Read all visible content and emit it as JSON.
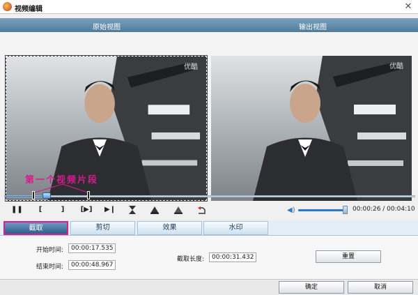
{
  "window": {
    "title": "视频编辑",
    "close_glyph": "✕"
  },
  "view_header": {
    "original_label": "原始视图",
    "output_label": "输出视图"
  },
  "preview": {
    "watermark": "优酷",
    "segment_note": "第一个视频片段"
  },
  "playback": {
    "current_time": "00:00:26",
    "total_time": "00:04:10",
    "timecode_display": "00:00:26 / 00:04:10",
    "progress_fraction": 0.104,
    "volume_fraction": 0.95,
    "buttons": {
      "pause": "❚❚",
      "mark_in": "[",
      "mark_out": "]",
      "play_segment": "[▶]",
      "step_to_end": "▶❙",
      "icons": [
        "pause-icon",
        "mark-in-icon",
        "mark-out-icon",
        "play-segment-icon",
        "step-end-icon",
        "cut-icon",
        "left-align-icon",
        "right-align-icon",
        "undo-icon"
      ]
    }
  },
  "tabs": [
    {
      "label": "截取",
      "active": true
    },
    {
      "label": "剪切",
      "active": false
    },
    {
      "label": "效果",
      "active": false
    },
    {
      "label": "水印",
      "active": false
    }
  ],
  "trim_panel": {
    "start_label": "开始时间:",
    "start_value": "00:00:17.535",
    "end_label": "结束时间:",
    "end_value": "00:00:48.967",
    "length_label": "截取长度:",
    "length_value": "00:00:31.432",
    "reset_label": "重置"
  },
  "footer": {
    "ok_label": "确定",
    "cancel_label": "取消"
  },
  "colors": {
    "accent": "#2f78c2",
    "highlight_border": "#e01b8c",
    "note_text": "#d81b8c"
  }
}
